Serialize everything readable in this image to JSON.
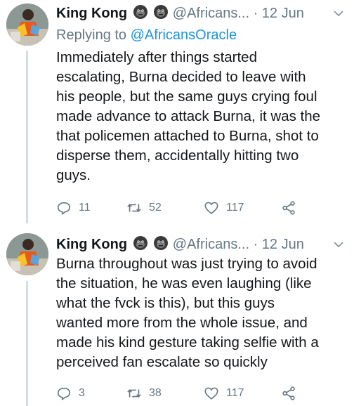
{
  "tweets": [
    {
      "name": "King Kong",
      "emoji": [
        "gorilla-emoji",
        "gorilla-emoji"
      ],
      "handle": "@Africans...",
      "separator": "·",
      "date": "12 Jun",
      "replying_prefix": "Replying to",
      "replying_to": "@AfricansOracle",
      "lines": [
        "Immediately after things started",
        "escalating, Burna decided to leave with",
        "his people, but the same guys crying foul",
        "made advance to attack Burna, it was the",
        "that policemen attached to Burna, shot to",
        "disperse them, accidentally hitting two",
        "guys."
      ],
      "replies": "11",
      "retweets": "52",
      "likes": "117"
    },
    {
      "name": "King Kong",
      "emoji": [
        "gorilla-emoji",
        "gorilla-emoji"
      ],
      "handle": "@Africans...",
      "separator": "·",
      "date": "12 Jun",
      "lines": [
        "Burna throughout was just trying to avoid",
        "the situation, he was even laughing (like",
        "what the fvck is this), but this guys",
        "wanted more from the whole issue, and",
        "made his kind gesture taking selfie with a",
        "perceived fan escalate so quickly"
      ],
      "replies": "3",
      "retweets": "38",
      "likes": "117"
    }
  ],
  "colors": {
    "text": "#14171a",
    "muted": "#657786",
    "link": "#1b95e0",
    "thread": "#d4dde3"
  },
  "icons": [
    "reply-icon",
    "retweet-icon",
    "like-icon",
    "share-icon",
    "chevron-down-icon"
  ]
}
